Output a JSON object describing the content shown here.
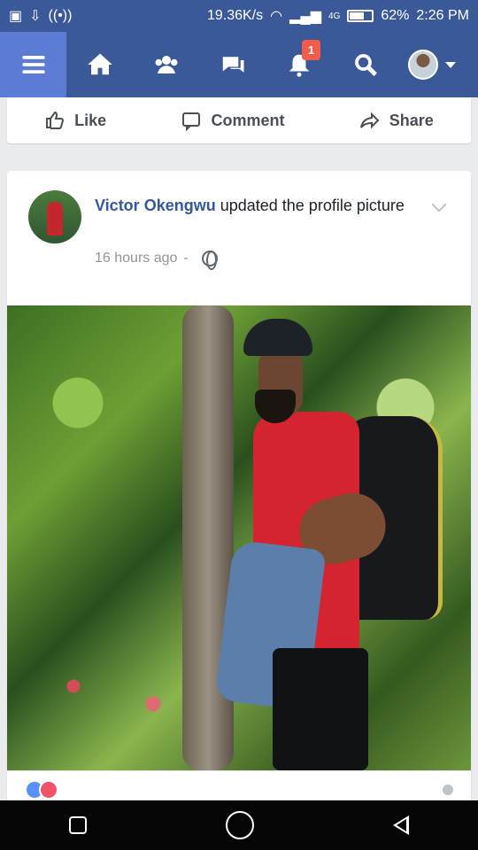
{
  "status_bar": {
    "network_speed": "19.36K/s",
    "network_type": "4G",
    "battery": "62%",
    "time": "2:26 PM",
    "icons": [
      "screenshot-icon",
      "download-icon",
      "hotspot-icon",
      "wifi-icon",
      "signal-icon",
      "battery-icon"
    ]
  },
  "nav": {
    "items": [
      {
        "name": "menu",
        "icon": "hamburger-menu-icon"
      },
      {
        "name": "home",
        "icon": "home-icon"
      },
      {
        "name": "friends",
        "icon": "friends-icon"
      },
      {
        "name": "messages",
        "icon": "messages-icon"
      },
      {
        "name": "notifications",
        "icon": "bell-icon",
        "badge": "1"
      },
      {
        "name": "search",
        "icon": "search-icon"
      },
      {
        "name": "profile",
        "icon": "profile-avatar"
      }
    ],
    "accent": "#3b5998",
    "active_background": "#5b7bd5",
    "badge_color": "#f25c4a"
  },
  "previous_post_actions": {
    "like": "Like",
    "comment": "Comment",
    "share": "Share"
  },
  "post": {
    "author": "Victor Okengwu",
    "activity": "updated the profile picture",
    "timestamp": "16 hours ago",
    "separator": "-",
    "privacy_icon": "globe-icon",
    "photo_description_icon": "profile-photo"
  },
  "post_footer": {
    "reaction_icons": [
      "like-reaction-icon",
      "love-reaction-icon"
    ]
  },
  "system_nav": {
    "icons": [
      "recent-apps-icon",
      "home-button-icon",
      "back-button-icon"
    ]
  }
}
